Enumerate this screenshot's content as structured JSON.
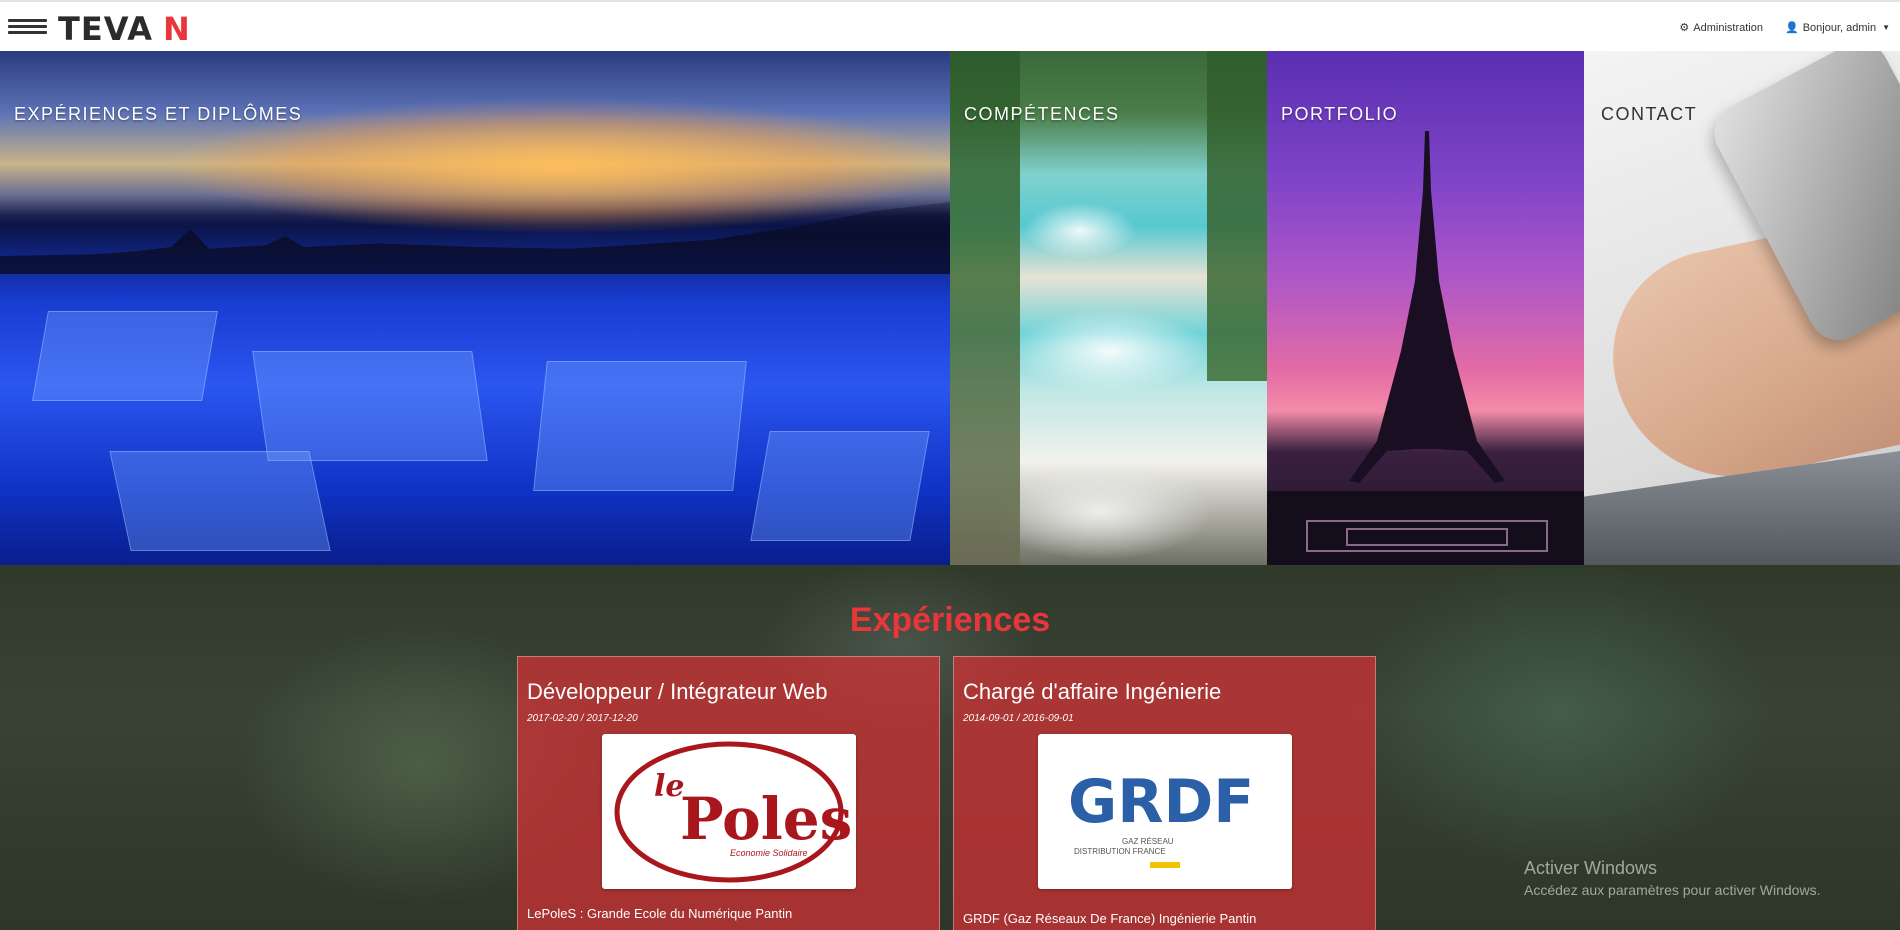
{
  "navbar": {
    "brand_main": "TEVA",
    "brand_accent": "N",
    "admin_label": "Administration",
    "user_label": "Bonjour, admin",
    "icons": {
      "menu": "hamburger-icon",
      "admin": "gear-icon",
      "user": "user-icon",
      "dropdown": "caret-down-icon"
    }
  },
  "hero": {
    "tiles": [
      {
        "label": "EXPÉRIENCES ET DIPLÔMES"
      },
      {
        "label": "COMPÉTENCES"
      },
      {
        "label": "PORTFOLIO"
      },
      {
        "label": "CONTACT"
      }
    ]
  },
  "experiences": {
    "title": "Expériences",
    "cards": [
      {
        "job_title": "Développeur / Intégrateur Web",
        "dates": "2017-02-20 / 2017-12-20",
        "logo_text_1": "le",
        "logo_text_2": "Poles",
        "logo_tagline": "Economie Solidaire",
        "company": "LePoleS : Grande Ecole du Numérique Pantin",
        "sub": "... ... ..."
      },
      {
        "job_title": "Chargé d'affaire Ingénierie",
        "dates": "2014-09-01 / 2016-09-01",
        "logo_text": "GRDF",
        "logo_sub_1": "GAZ RÉSEAU",
        "logo_sub_2": "DISTRIBUTION FRANCE",
        "company": "GRDF (Gaz Réseaux De France) Ingénierie Pantin"
      }
    ]
  },
  "watermark": {
    "line1": "Activer Windows",
    "line2": "Accédez aux paramètres pour activer Windows."
  },
  "colors": {
    "accent": "#e8363a",
    "card": "#d63034"
  }
}
